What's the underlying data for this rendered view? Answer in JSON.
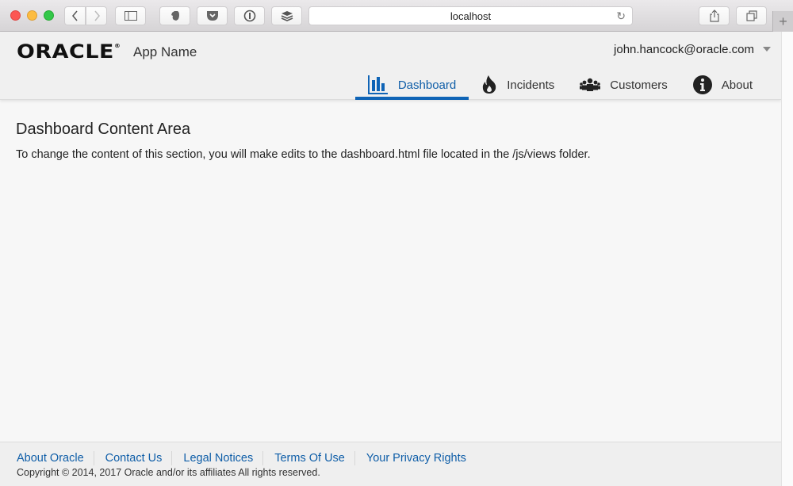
{
  "browser": {
    "url": "localhost",
    "buttons": {
      "back": "‹",
      "forward": "›",
      "new_tab": "+"
    }
  },
  "header": {
    "logo": "ORACLE",
    "logo_mark": "®",
    "app_name": "App Name",
    "user": "john.hancock@oracle.com"
  },
  "nav": {
    "items": [
      {
        "label": "Dashboard",
        "icon": "bar-chart-icon",
        "active": true
      },
      {
        "label": "Incidents",
        "icon": "fire-icon",
        "active": false
      },
      {
        "label": "Customers",
        "icon": "people-icon",
        "active": false
      },
      {
        "label": "About",
        "icon": "info-icon",
        "active": false
      }
    ]
  },
  "content": {
    "title": "Dashboard Content Area",
    "body": "To change the content of this section, you will make edits to the dashboard.html file located in the /js/views folder."
  },
  "footer": {
    "links": [
      "About Oracle",
      "Contact Us",
      "Legal Notices",
      "Terms Of Use",
      "Your Privacy Rights"
    ],
    "copyright": "Copyright © 2014, 2017 Oracle and/or its affiliates All rights reserved."
  },
  "colors": {
    "accent": "#0f64b6",
    "link": "#0f5ea8"
  }
}
